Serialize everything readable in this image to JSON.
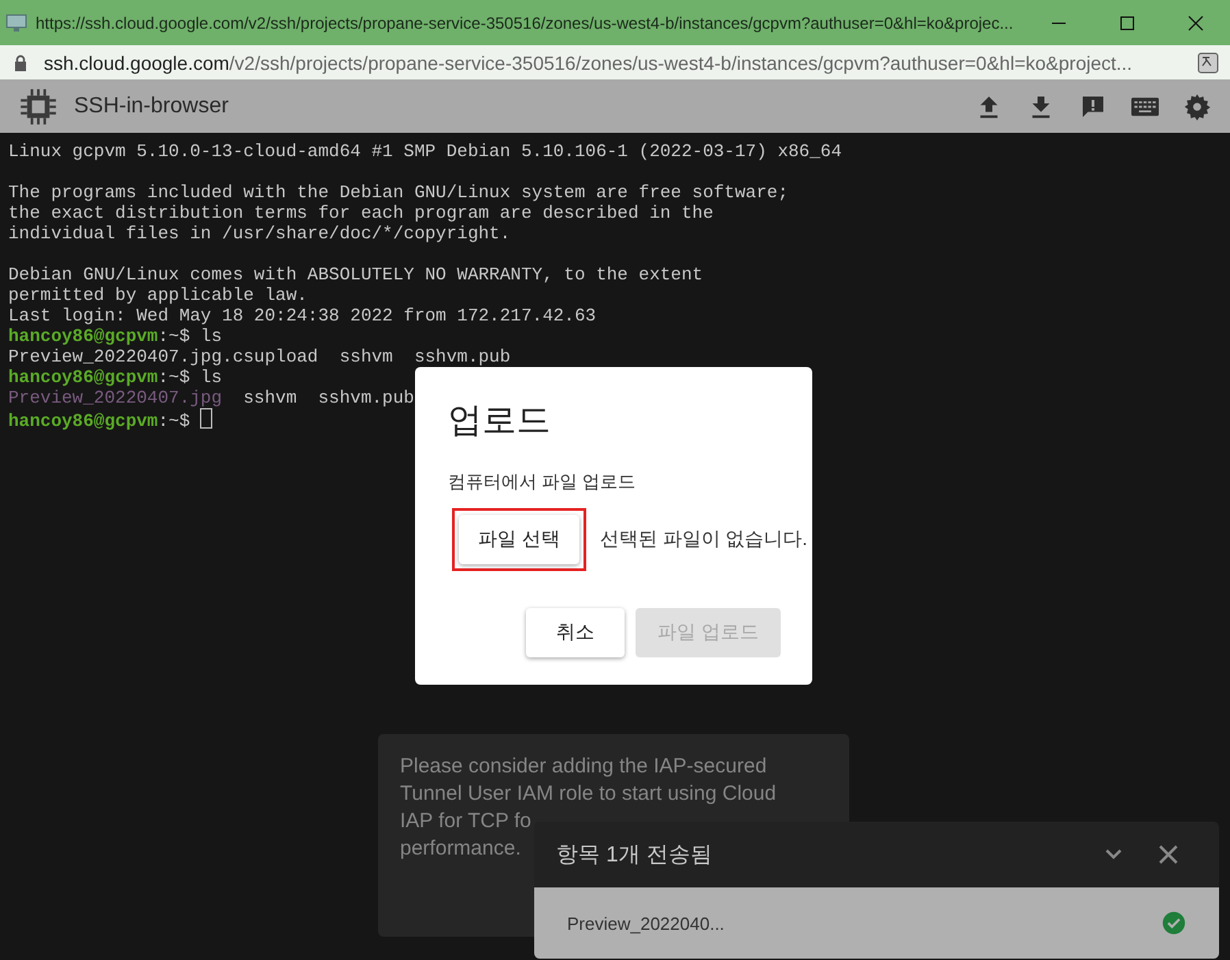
{
  "browser": {
    "title_url": "https://ssh.cloud.google.com/v2/ssh/projects/propane-service-350516/zones/us-west4-b/instances/gcpvm?authuser=0&hl=ko&projec...",
    "address": {
      "host": "ssh.cloud.google.com",
      "path": "/v2/ssh/projects/propane-service-350516/zones/us-west4-b/instances/gcpvm?authuser=0&hl=ko&project..."
    }
  },
  "app_header": {
    "title": "SSH-in-browser"
  },
  "terminal": {
    "lines": [
      [
        {
          "kind": "plain",
          "text": "Linux gcpvm 5.10.0-13-cloud-amd64 #1 SMP Debian 5.10.106-1 (2022-03-17) x86_64"
        }
      ],
      [
        {
          "kind": "blank"
        }
      ],
      [
        {
          "kind": "plain",
          "text": "The programs included with the Debian GNU/Linux system are free software;"
        }
      ],
      [
        {
          "kind": "plain",
          "text": "the exact distribution terms for each program are described in the"
        }
      ],
      [
        {
          "kind": "plain",
          "text": "individual files in /usr/share/doc/*/copyright."
        }
      ],
      [
        {
          "kind": "blank"
        }
      ],
      [
        {
          "kind": "plain",
          "text": "Debian GNU/Linux comes with ABSOLUTELY NO WARRANTY, to the extent"
        }
      ],
      [
        {
          "kind": "plain",
          "text": "permitted by applicable law."
        }
      ],
      [
        {
          "kind": "plain",
          "text": "Last login: Wed May 18 20:24:38 2022 from 172.217.42.63"
        }
      ],
      [
        {
          "kind": "user",
          "text": "hancoy86@gcpvm"
        },
        {
          "kind": "plain",
          "text": ":~$ ls"
        }
      ],
      [
        {
          "kind": "plain",
          "text": "Preview_20220407.jpg.csupload  sshvm  sshvm.pub"
        }
      ],
      [
        {
          "kind": "user",
          "text": "hancoy86@gcpvm"
        },
        {
          "kind": "plain",
          "text": ":~$ ls"
        }
      ],
      [
        {
          "kind": "image",
          "text": "Preview_20220407.jpg"
        },
        {
          "kind": "plain",
          "text": "  sshvm  sshvm.pub"
        }
      ],
      [
        {
          "kind": "user",
          "text": "hancoy86@gcpvm"
        },
        {
          "kind": "plain",
          "text": ":~$ "
        },
        {
          "kind": "cursor"
        }
      ]
    ]
  },
  "dialog": {
    "title": "업로드",
    "subtitle": "컴퓨터에서 파일 업로드",
    "choose_button": {
      "label": "파일 선택",
      "highlighted": true
    },
    "no_file_text": "선택된 파일이 없습니다.",
    "buttons": [
      {
        "label": "취소",
        "disabled": false
      },
      {
        "label": "파일 업로드",
        "disabled": true
      }
    ]
  },
  "toast": {
    "lines": [
      "Please consider adding the IAP-secured",
      "Tunnel User IAM role to start using Cloud",
      "IAP for TCP fo",
      "performance."
    ]
  },
  "transfer_panel": {
    "title": "항목 1개 전송됨",
    "items": [
      {
        "name": "Preview_2022040...",
        "done": true
      }
    ]
  }
}
